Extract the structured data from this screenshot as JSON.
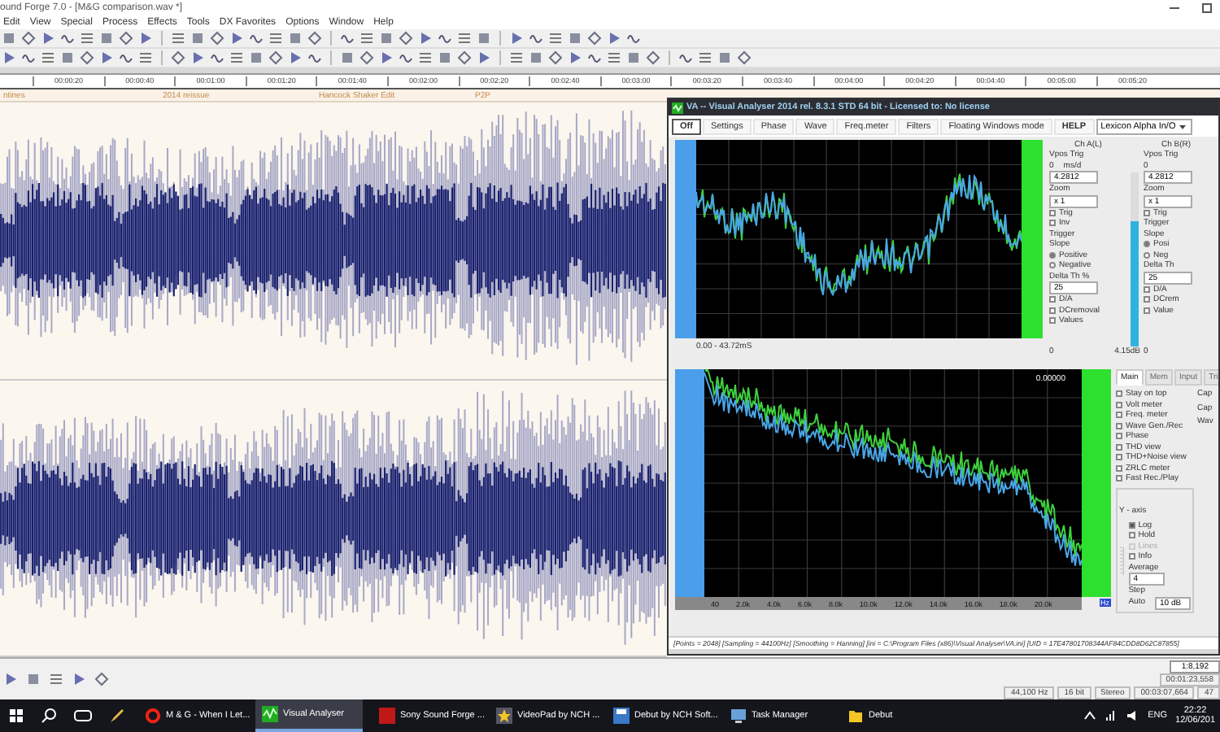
{
  "sound_forge": {
    "title": "ound Forge 7.0 - [M&G comparison.wav *]",
    "menu": [
      "Edit",
      "View",
      "Special",
      "Process",
      "Effects",
      "Tools",
      "DX Favorites",
      "Options",
      "Window",
      "Help"
    ],
    "ruler": [
      "00:00:20",
      "00:00:40",
      "00:01:00",
      "00:01:20",
      "00:01:40",
      "00:02:00",
      "00:02:20",
      "00:02:40",
      "00:03:00",
      "00:03:20",
      "00:03:40",
      "00:04:00",
      "00:04:20",
      "00:04:40",
      "00:05:00",
      "00:05:20"
    ],
    "markers": [
      "ntines",
      "2014 reissue",
      "Hancock Shaker Edit",
      "P2P"
    ],
    "zoom_ratio": "1:8,192",
    "cursor_position": "00:01:23,558",
    "status": [
      "44,100 Hz",
      "16 bit",
      "Stereo",
      "00:03:07,664",
      "47"
    ]
  },
  "visual_analyser": {
    "title": "VA -- Visual Analyser 2014 rel. 8.3.1 STD 64 bit - Licensed to: No license",
    "toolbar": [
      {
        "label": "Off",
        "pressed": true,
        "bold": true
      },
      {
        "label": "Settings",
        "pressed": false,
        "bold": false
      },
      {
        "label": "Phase",
        "pressed": false,
        "bold": false
      },
      {
        "label": "Wave",
        "pressed": false,
        "bold": false
      },
      {
        "label": "Freq.meter",
        "pressed": false,
        "bold": false
      },
      {
        "label": "Filters",
        "pressed": false,
        "bold": false
      },
      {
        "label": "Floating Windows mode",
        "pressed": false,
        "bold": false
      },
      {
        "label": "HELP",
        "pressed": false,
        "bold": true
      }
    ],
    "device": "Lexicon Alpha In/O",
    "scope": {
      "time_range": "0.00 - 43.72mS",
      "channels": [
        {
          "rows": [
            {
              "kind": "header",
              "text": "Ch A(L)"
            },
            {
              "kind": "label",
              "text": "Vpos Trig"
            },
            {
              "kind": "pair",
              "texts": [
                "0",
                "ms/d"
              ]
            },
            {
              "kind": "field",
              "text": "4.2812"
            },
            {
              "kind": "label",
              "text": "Zoom"
            },
            {
              "kind": "field",
              "text": "x 1"
            },
            {
              "kind": "check",
              "text": "Trig",
              "checked": false
            },
            {
              "kind": "check",
              "text": "Inv",
              "checked": false
            },
            {
              "kind": "label",
              "text": "Trigger"
            },
            {
              "kind": "label",
              "text": "Slope"
            },
            {
              "kind": "radio",
              "text": "Positive",
              "checked": true
            },
            {
              "kind": "radio",
              "text": "Negative",
              "checked": false
            },
            {
              "kind": "label",
              "text": "Delta Th %"
            },
            {
              "kind": "field",
              "text": "25"
            },
            {
              "kind": "check",
              "text": "D/A",
              "checked": false
            },
            {
              "kind": "check",
              "text": "DCremoval",
              "checked": false
            },
            {
              "kind": "check",
              "text": "Values",
              "checked": false
            }
          ],
          "vpos": "0",
          "level": 0.72,
          "reading": "4.15dB"
        },
        {
          "rows": [
            {
              "kind": "header",
              "text": "Ch B(R)"
            },
            {
              "kind": "label",
              "text": "Vpos Trig"
            },
            {
              "kind": "pair",
              "texts": [
                "0"
              ]
            },
            {
              "kind": "field",
              "text": "4.2812"
            },
            {
              "kind": "label",
              "text": "Zoom"
            },
            {
              "kind": "field",
              "text": "x 1"
            },
            {
              "kind": "check",
              "text": "Trig",
              "checked": false
            },
            {
              "kind": "label",
              "text": "Trigger"
            },
            {
              "kind": "label",
              "text": "Slope"
            },
            {
              "kind": "radio",
              "text": "Posi",
              "checked": true
            },
            {
              "kind": "radio",
              "text": "Neg",
              "checked": false
            },
            {
              "kind": "label",
              "text": "Delta Th"
            },
            {
              "kind": "field",
              "text": "25"
            },
            {
              "kind": "check",
              "text": "D/A",
              "checked": false
            },
            {
              "kind": "check",
              "text": "DCrem",
              "checked": false
            },
            {
              "kind": "check",
              "text": "Value",
              "checked": false
            }
          ],
          "vpos": "0"
        }
      ]
    },
    "spectrum": {
      "readout": "0.00000",
      "x_labels": [
        "40",
        "2.0k",
        "4.0k",
        "6.0k",
        "8.0k",
        "10.0k",
        "12.0k",
        "14.0k",
        "16.0k",
        "18.0k",
        "20.0k"
      ],
      "unit": "Hz"
    },
    "tabs": [
      {
        "label": "Main",
        "selected": true
      },
      {
        "label": "Mem",
        "selected": false
      },
      {
        "label": "Input",
        "selected": false
      },
      {
        "label": "Tri",
        "selected": false
      }
    ],
    "options": [
      {
        "label": "Stay on top",
        "checked": false
      },
      {
        "label": "Volt meter",
        "checked": false
      },
      {
        "label": "Freq. meter",
        "checked": false
      },
      {
        "label": "Wave Gen./Rec",
        "checked": false
      },
      {
        "label": "Phase",
        "checked": false
      },
      {
        "label": "THD view",
        "checked": false
      },
      {
        "label": "THD+Noise view",
        "checked": false
      },
      {
        "label": "ZRLC meter",
        "checked": false
      },
      {
        "label": "Fast Rec./Play",
        "checked": false
      }
    ],
    "y_axis": {
      "title": "Y - axis",
      "options": [
        {
          "label": "Log",
          "checked": true,
          "disabled": false
        },
        {
          "label": "Hold",
          "checked": false,
          "disabled": false
        },
        {
          "label": "Lines",
          "checked": false,
          "disabled": true
        },
        {
          "label": "Info",
          "checked": false,
          "disabled": false
        }
      ],
      "average_label": "Average",
      "average": "4",
      "step_label": "Step",
      "step": "10 dB",
      "auto": "Auto"
    },
    "side_cut": [
      "Cap",
      "Cap",
      "Wav"
    ],
    "status_line": "[Points = 2048] [Sampling = 44100Hz] [Smoothing = Hanning] [ini = C:\\Program Files (x86)\\Visual Analyser\\VA.ini] [UID = 17E47801708344AF84CDD8D62C87855]"
  },
  "taskbar": {
    "apps": [
      {
        "label": "M & G - When I Let...",
        "active": false
      },
      {
        "label": "Visual Analyser",
        "active": true
      },
      {
        "label": "Sony Sound Forge ...",
        "active": false
      },
      {
        "label": "VideoPad by NCH ...",
        "active": false
      },
      {
        "label": "Debut by NCH Soft...",
        "active": false
      },
      {
        "label": "Task Manager",
        "active": false
      },
      {
        "label": "Debut",
        "active": false
      }
    ],
    "language": "ENG",
    "time": "22:22",
    "date": "12/06/201"
  }
}
